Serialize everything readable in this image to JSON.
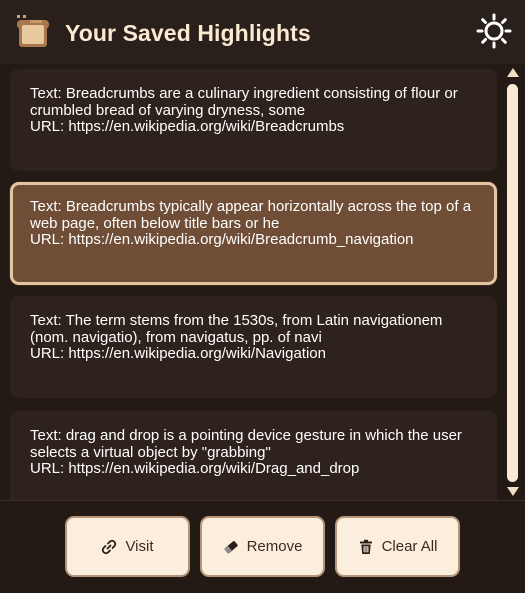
{
  "header": {
    "title": "Your Saved Highlights",
    "logo_icon": "toast-logo-icon",
    "theme_toggle_icon": "sun-icon"
  },
  "highlights": [
    {
      "text": "Text: Breadcrumbs are a culinary ingredient consisting of flour or",
      "text2": "crumbled bread of varying dryness, some",
      "url": "URL: https://en.wikipedia.org/wiki/Breadcrumbs"
    },
    {
      "text": "Text: Breadcrumbs typically appear horizontally across the top of a",
      "text2": "web page, often below title bars or he",
      "url": "URL: https://en.wikipedia.org/wiki/Breadcrumb_navigation",
      "selected": true
    },
    {
      "text": "Text: The term stems from the 1530s, from Latin navigationem",
      "text2": "(nom. navigatio), from navigatus, pp. of navi",
      "url": "URL: https://en.wikipedia.org/wiki/Navigation"
    },
    {
      "text": "Text: drag and drop is a pointing device gesture in which the user",
      "text2": "selects a virtual object by \"grabbing\"",
      "url": "URL: https://en.wikipedia.org/wiki/Drag_and_drop"
    }
  ],
  "footer": {
    "visit_label": "Visit",
    "visit_icon": "link-icon",
    "remove_label": "Remove",
    "remove_icon": "eraser-icon",
    "clear_label": "Clear All",
    "clear_icon": "trash-icon"
  },
  "colors": {
    "background": "#241a15",
    "card": "#2e221c",
    "card_selected": "#6f4d36",
    "card_selected_border": "#e3c6a1",
    "title_text": "#fbe9d2",
    "button_bg": "#fbeedd"
  }
}
